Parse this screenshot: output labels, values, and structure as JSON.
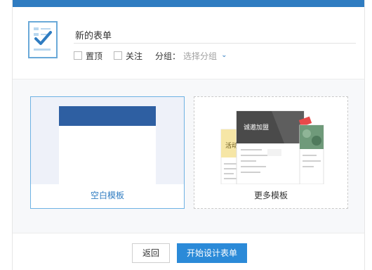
{
  "header": {
    "title_value": "新的表单",
    "pin_label": "置顶",
    "follow_label": "关注",
    "group_label": "分组：",
    "group_placeholder": "选择分组",
    "group_chevron": "chevron-down-icon"
  },
  "templates": {
    "blank_label": "空白模板",
    "more_label": "更多模板",
    "preview_banner_text": "诚邀加盟",
    "preview_side_text": "活动"
  },
  "footer": {
    "back_label": "返回",
    "start_label": "开始设计表单"
  },
  "colors": {
    "accent": "#2f7cc1",
    "header_bar": "#2e5fa2",
    "primary_button": "#2b8ad8"
  }
}
